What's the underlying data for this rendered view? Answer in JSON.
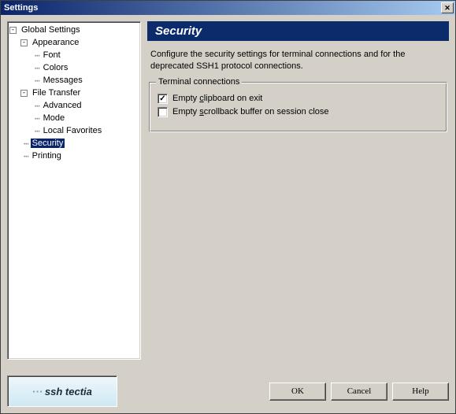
{
  "window": {
    "title": "Settings"
  },
  "tree": {
    "root": "Global Settings",
    "appearance": {
      "label": "Appearance",
      "children": [
        "Font",
        "Colors",
        "Messages"
      ]
    },
    "file_transfer": {
      "label": "File Transfer",
      "children": [
        "Advanced",
        "Mode",
        "Local Favorites"
      ]
    },
    "security": "Security",
    "printing": "Printing"
  },
  "page": {
    "title": "Security",
    "description": "Configure the security settings for terminal connections and for the deprecated SSH1 protocol connections.",
    "group": {
      "legend": "Terminal connections",
      "opt1": {
        "label_pre": "Empty ",
        "hot": "c",
        "label_post": "lipboard on exit",
        "checked": true
      },
      "opt2": {
        "label_pre": "Empty ",
        "hot": "s",
        "label_post": "crollback buffer on session close",
        "checked": false
      }
    }
  },
  "buttons": {
    "ok": "OK",
    "cancel": "Cancel",
    "help": "Help"
  },
  "logo": "ssh tectia"
}
